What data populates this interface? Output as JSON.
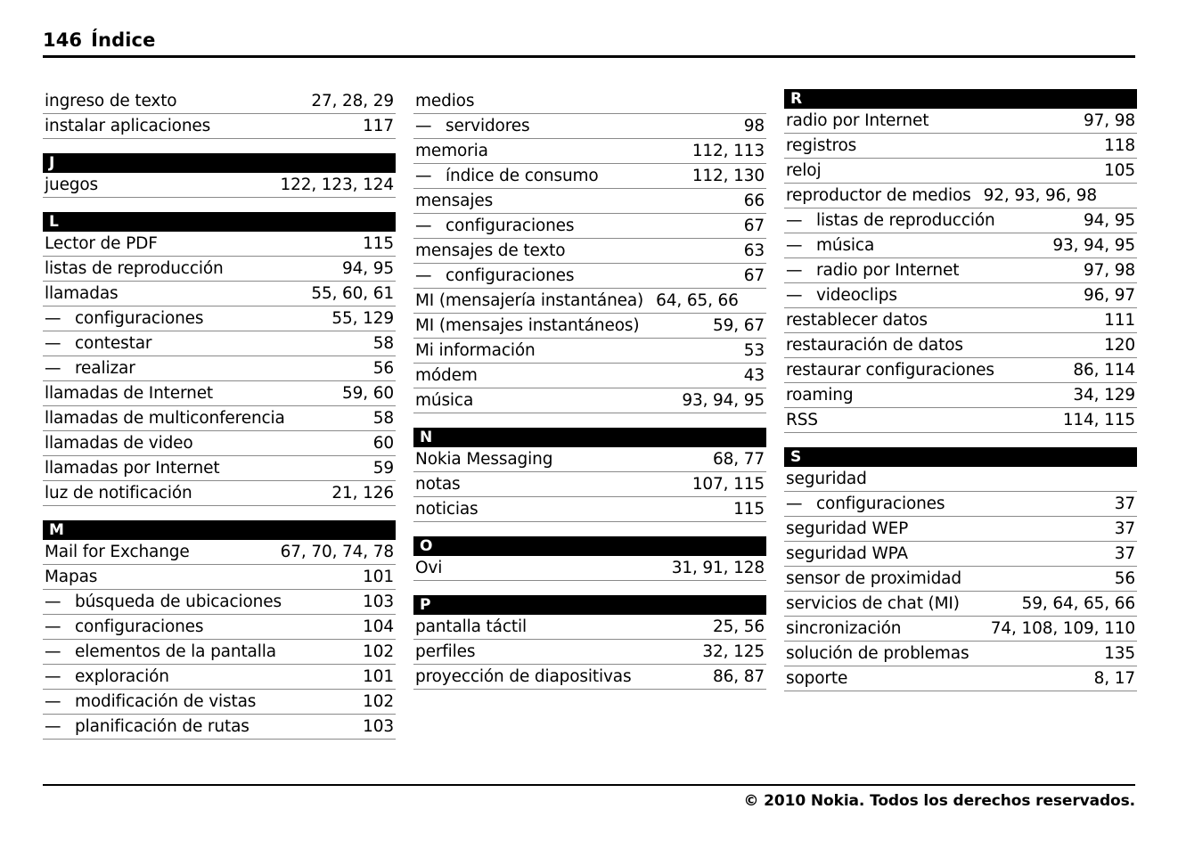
{
  "header": {
    "page_number": "146",
    "title": "Índice"
  },
  "footer": {
    "copyright": "© 2010 Nokia. Todos los derechos reservados."
  },
  "columns": [
    {
      "id": "column-1",
      "groups": [
        {
          "letter": null,
          "entries": [
            {
              "term": "ingreso de texto",
              "pages": "27, 28, 29",
              "sub": false
            },
            {
              "term": "instalar aplicaciones",
              "pages": "117",
              "sub": false
            }
          ]
        },
        {
          "letter": "J",
          "entries": [
            {
              "term": "juegos",
              "pages": "122, 123, 124",
              "sub": false
            }
          ]
        },
        {
          "letter": "L",
          "entries": [
            {
              "term": "Lector de PDF",
              "pages": "115",
              "sub": false
            },
            {
              "term": "listas de reproducción",
              "pages": "94, 95",
              "sub": false
            },
            {
              "term": "llamadas",
              "pages": "55, 60, 61",
              "sub": false
            },
            {
              "term": "configuraciones",
              "pages": "55, 129",
              "sub": true
            },
            {
              "term": "contestar",
              "pages": "58",
              "sub": true
            },
            {
              "term": "realizar",
              "pages": "56",
              "sub": true
            },
            {
              "term": "llamadas de Internet",
              "pages": "59, 60",
              "sub": false
            },
            {
              "term": "llamadas de multiconferencia",
              "pages": "58",
              "sub": false
            },
            {
              "term": "llamadas de video",
              "pages": "60",
              "sub": false
            },
            {
              "term": "llamadas por Internet",
              "pages": "59",
              "sub": false
            },
            {
              "term": "luz de notificación",
              "pages": "21, 126",
              "sub": false
            }
          ]
        },
        {
          "letter": "M",
          "entries": [
            {
              "term": "Mail for Exchange",
              "pages": "67, 70, 74, 78",
              "sub": false
            },
            {
              "term": "Mapas",
              "pages": "101",
              "sub": false
            },
            {
              "term": "búsqueda de ubicaciones",
              "pages": "103",
              "sub": true
            },
            {
              "term": "configuraciones",
              "pages": "104",
              "sub": true
            },
            {
              "term": "elementos de la pantalla",
              "pages": "102",
              "sub": true
            },
            {
              "term": "exploración",
              "pages": "101",
              "sub": true
            },
            {
              "term": "modificación de vistas",
              "pages": "102",
              "sub": true
            },
            {
              "term": "planificación de rutas",
              "pages": "103",
              "sub": true
            }
          ]
        }
      ]
    },
    {
      "id": "column-2",
      "groups": [
        {
          "letter": null,
          "entries": [
            {
              "term": "medios",
              "pages": "",
              "sub": false
            },
            {
              "term": "servidores",
              "pages": "98",
              "sub": true
            },
            {
              "term": "memoria",
              "pages": "112, 113",
              "sub": false
            },
            {
              "term": "índice de consumo",
              "pages": "112, 130",
              "sub": true
            },
            {
              "term": "mensajes",
              "pages": "66",
              "sub": false
            },
            {
              "term": "configuraciones",
              "pages": "67",
              "sub": true
            },
            {
              "term": "mensajes de texto",
              "pages": "63",
              "sub": false
            },
            {
              "term": "configuraciones",
              "pages": "67",
              "sub": true
            },
            {
              "term": "MI (mensajería instantánea)",
              "pages": "64, 65, 66",
              "sub": false,
              "wrap": true
            },
            {
              "term": "MI (mensajes instantáneos)",
              "pages": "59, 67",
              "sub": false
            },
            {
              "term": "Mi información",
              "pages": "53",
              "sub": false
            },
            {
              "term": "módem",
              "pages": "43",
              "sub": false
            },
            {
              "term": "música",
              "pages": "93, 94, 95",
              "sub": false
            }
          ]
        },
        {
          "letter": "N",
          "entries": [
            {
              "term": "Nokia Messaging",
              "pages": "68, 77",
              "sub": false
            },
            {
              "term": "notas",
              "pages": "107, 115",
              "sub": false
            },
            {
              "term": "noticias",
              "pages": "115",
              "sub": false
            }
          ]
        },
        {
          "letter": "O",
          "entries": [
            {
              "term": "Ovi",
              "pages": "31, 91, 128",
              "sub": false
            }
          ]
        },
        {
          "letter": "P",
          "entries": [
            {
              "term": "pantalla táctil",
              "pages": "25, 56",
              "sub": false
            },
            {
              "term": "perfiles",
              "pages": "32, 125",
              "sub": false
            },
            {
              "term": "proyección de diapositivas",
              "pages": "86, 87",
              "sub": false
            }
          ]
        }
      ]
    },
    {
      "id": "column-3",
      "groups": [
        {
          "letter": "R",
          "entries": [
            {
              "term": "radio por Internet",
              "pages": "97, 98",
              "sub": false
            },
            {
              "term": "registros",
              "pages": "118",
              "sub": false
            },
            {
              "term": "reloj",
              "pages": "105",
              "sub": false
            },
            {
              "term": "reproductor de medios",
              "pages": "92, 93, 96, 98",
              "sub": false,
              "wrap": true
            },
            {
              "term": "listas de reproducción",
              "pages": "94, 95",
              "sub": true
            },
            {
              "term": "música",
              "pages": "93, 94, 95",
              "sub": true
            },
            {
              "term": "radio por Internet",
              "pages": "97, 98",
              "sub": true
            },
            {
              "term": "videoclips",
              "pages": "96, 97",
              "sub": true
            },
            {
              "term": "restablecer datos",
              "pages": "111",
              "sub": false
            },
            {
              "term": "restauración de datos",
              "pages": "120",
              "sub": false
            },
            {
              "term": "restaurar configuraciones",
              "pages": "86, 114",
              "sub": false
            },
            {
              "term": "roaming",
              "pages": "34, 129",
              "sub": false
            },
            {
              "term": "RSS",
              "pages": "114, 115",
              "sub": false
            }
          ]
        },
        {
          "letter": "S",
          "entries": [
            {
              "term": "seguridad",
              "pages": "",
              "sub": false
            },
            {
              "term": "configuraciones",
              "pages": "37",
              "sub": true
            },
            {
              "term": "seguridad WEP",
              "pages": "37",
              "sub": false
            },
            {
              "term": "seguridad WPA",
              "pages": "37",
              "sub": false
            },
            {
              "term": "sensor de proximidad",
              "pages": "56",
              "sub": false
            },
            {
              "term": "servicios de chat (MI)",
              "pages": "59, 64, 65, 66",
              "sub": false
            },
            {
              "term": "sincronización",
              "pages": "74, 108, 109, 110",
              "sub": false
            },
            {
              "term": "solución de problemas",
              "pages": "135",
              "sub": false
            },
            {
              "term": "soporte",
              "pages": "8, 17",
              "sub": false
            }
          ]
        }
      ]
    }
  ]
}
